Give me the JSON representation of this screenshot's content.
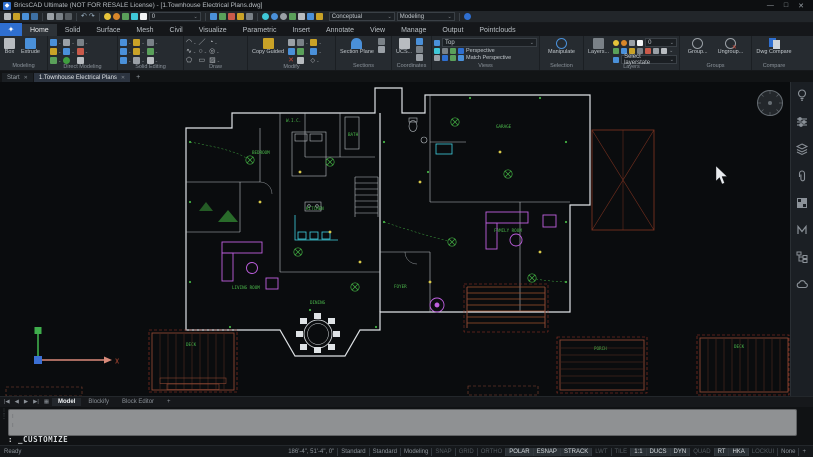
{
  "title_bar": {
    "title": "BricsCAD Ultimate (NOT FOR RESALE License) - [1.Townhouse Electrical Plans.dwg]"
  },
  "qat": {
    "layer_value": "0",
    "render_style": "Conceptual",
    "workspace": "Modeling"
  },
  "ribbon": {
    "tabs": [
      "Home",
      "Solid",
      "Surface",
      "Mesh",
      "Civil",
      "Visualize",
      "Parametric",
      "Insert",
      "Annotate",
      "View",
      "Manage",
      "Output",
      "Pointclouds"
    ],
    "groups": {
      "modeling": {
        "label": "Modeling",
        "box": "Box",
        "extrude": "Extrude"
      },
      "direct_modeling": {
        "label": "Direct Modeling"
      },
      "solid_editing": {
        "label": "Solid Editing"
      },
      "draw": {
        "label": "Draw"
      },
      "modify": {
        "label": "Modify",
        "copy_guided": "Copy Guided"
      },
      "sections": {
        "label": "Sections",
        "section_plane": "Section Plane"
      },
      "coordinates": {
        "label": "Coordinates",
        "ucs": "UCS..."
      },
      "views": {
        "label": "Views",
        "view_selected": "Top",
        "perspective": "Perspective",
        "match_perspective": "Match Perspective"
      },
      "selection": {
        "label": "Selection",
        "manipulate": "Manipulate"
      },
      "layers": {
        "label": "Layers",
        "layers_button": "Layers...",
        "layer_value": "0",
        "layerstate": "Select layerstate"
      },
      "groups": {
        "label": "Groups",
        "group": "Group...",
        "ungroup": "Ungroup..."
      },
      "compare": {
        "label": "Compare",
        "dwg_compare": "Dwg Compare"
      }
    }
  },
  "document_tabs": {
    "start": "Start",
    "active": "1.Townhouse Electrical Plans",
    "add": "+"
  },
  "layout_tabs": {
    "model": "Model",
    "blockify": "Blockify",
    "block_editor": "Block Editor",
    "add": "+"
  },
  "command_line": {
    "prompt": ":",
    "text": "_CUSTOMIZE"
  },
  "status_bar": {
    "ready": "Ready",
    "coords": "186'-4\", 51'-4\", 0\"",
    "fields": [
      {
        "label": "Standard",
        "state": "plainb"
      },
      {
        "label": "Standard",
        "state": "plainb"
      },
      {
        "label": "Modeling",
        "state": "plainb"
      },
      {
        "label": "SNAP",
        "state": "off"
      },
      {
        "label": "GRID",
        "state": "off"
      },
      {
        "label": "ORTHO",
        "state": "off"
      },
      {
        "label": "POLAR",
        "state": "on"
      },
      {
        "label": "ESNAP",
        "state": "on"
      },
      {
        "label": "STRACK",
        "state": "on"
      },
      {
        "label": "LWT",
        "state": "off"
      },
      {
        "label": "TILE",
        "state": "off"
      },
      {
        "label": "1:1",
        "state": "on"
      },
      {
        "label": "DUCS",
        "state": "on"
      },
      {
        "label": "DYN",
        "state": "on"
      },
      {
        "label": "QUAD",
        "state": "off"
      },
      {
        "label": "RT",
        "state": "on"
      },
      {
        "label": "HKA",
        "state": "on"
      },
      {
        "label": "LOCKUI",
        "state": "off"
      },
      {
        "label": "None",
        "state": "plain"
      },
      {
        "label": "+",
        "state": "plain"
      }
    ]
  },
  "canvas": {
    "ucs_x_label": "X",
    "labels": [
      "BEDROOM",
      "BATH",
      "KITCHEN",
      "DINING",
      "LIVING ROOM",
      "FOYER",
      "FAMILY ROOM",
      "GARAGE",
      "DECK",
      "PORCH",
      "DECK",
      "W.I.C."
    ]
  },
  "colors": {
    "accent_blue": "#2f6fd0",
    "wall": "#dfe3e6",
    "electrical_green": "#4dbd4d",
    "deck_brown": "#8a4632",
    "furniture_magenta": "#bf5fe0",
    "counter_cyan": "#3fd0e0"
  }
}
